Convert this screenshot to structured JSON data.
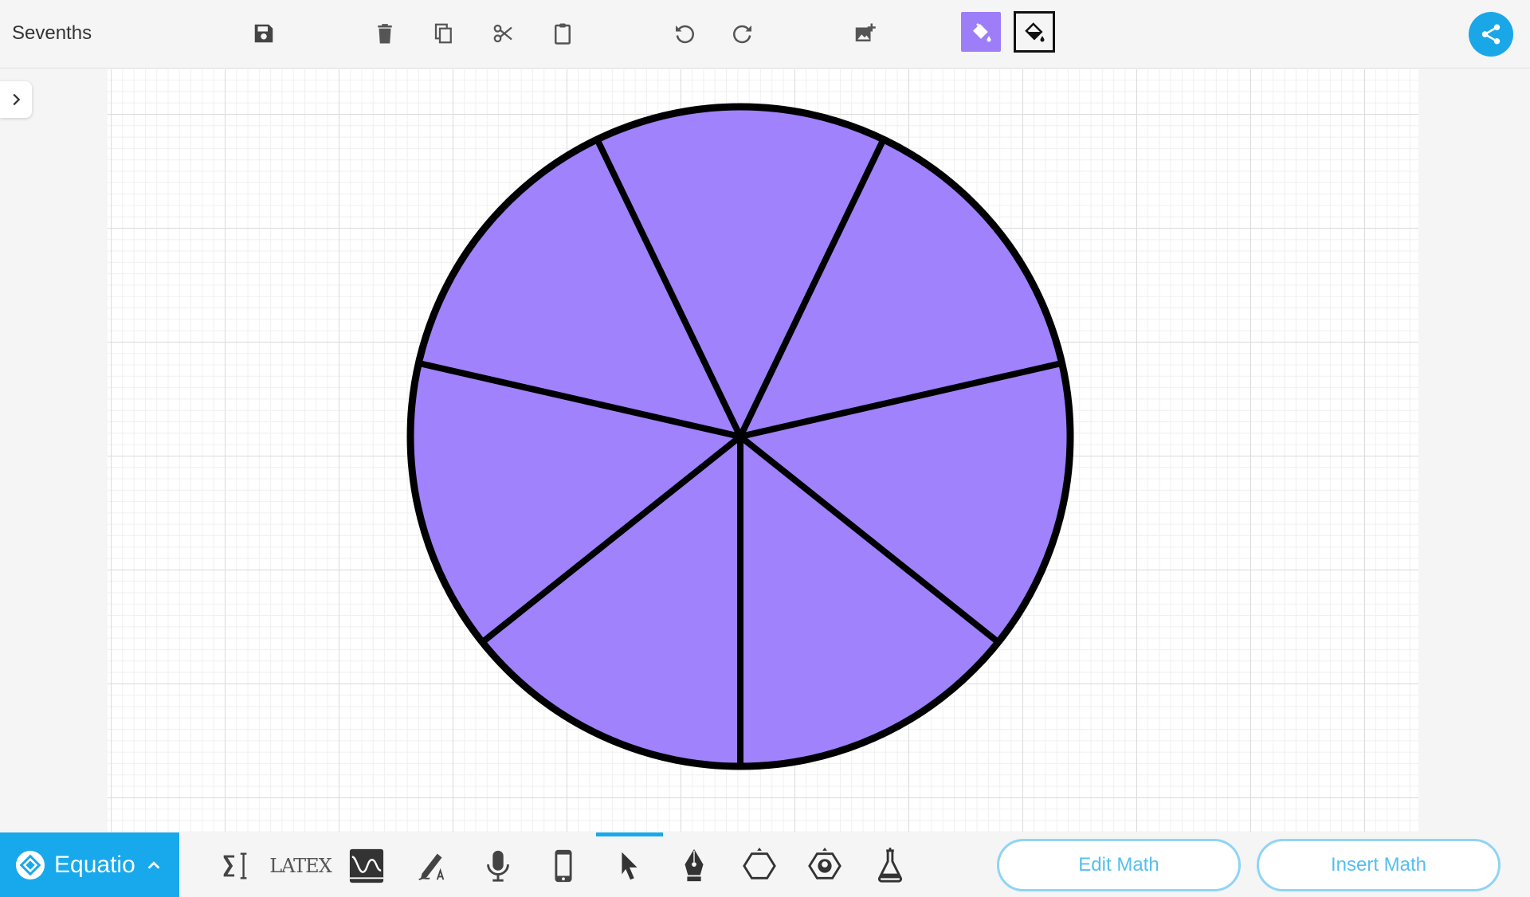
{
  "document": {
    "title": "Sevenths"
  },
  "toolbar": {
    "save_icon": "save-icon",
    "delete_icon": "trash-icon",
    "copy_icon": "copy-icon",
    "cut_icon": "scissors-icon",
    "paste_icon": "clipboard-icon",
    "undo_icon": "undo-icon",
    "redo_icon": "redo-icon",
    "add_image_icon": "add-image-icon",
    "fill_color_icon": "paint-bucket-icon",
    "fill_outline_icon": "paint-bucket-outline-icon",
    "share_icon": "share-icon"
  },
  "colors": {
    "accent": "#17a9ec",
    "fill_active": "#9d7ef8",
    "shape_fill": "#9f82fc",
    "shape_stroke": "#000000"
  },
  "canvas": {
    "shape": "circle",
    "slices": 7,
    "fill_color": "#9f82fc",
    "stroke_color": "#000000"
  },
  "bottom": {
    "brand": "Equatio",
    "tools": [
      {
        "name": "math-input-tool",
        "icon": "sigma-cursor-icon"
      },
      {
        "name": "latex-tool",
        "label": "LATEX",
        "icon": "latex-icon"
      },
      {
        "name": "graph-tool",
        "icon": "graph-icon"
      },
      {
        "name": "handwriting-tool",
        "icon": "pen-write-icon"
      },
      {
        "name": "speech-tool",
        "icon": "microphone-icon"
      },
      {
        "name": "mobile-tool",
        "icon": "phone-icon"
      },
      {
        "name": "select-tool",
        "icon": "cursor-icon",
        "active": true
      },
      {
        "name": "pen-tool",
        "icon": "pen-nib-icon"
      },
      {
        "name": "shape-tool",
        "icon": "hexagon-icon"
      },
      {
        "name": "stamp-tool",
        "icon": "stamp-icon"
      },
      {
        "name": "chemistry-tool",
        "icon": "flask-icon"
      }
    ],
    "edit_math": "Edit Math",
    "insert_math": "Insert Math"
  }
}
